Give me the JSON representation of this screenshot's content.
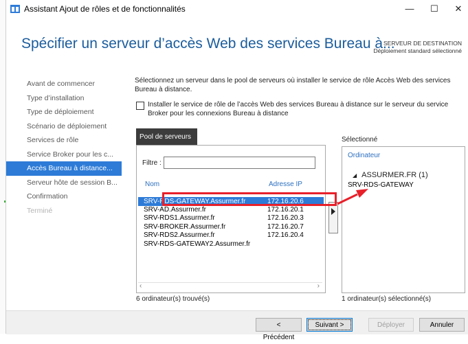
{
  "window": {
    "title": "Assistant Ajout de rôles et de fonctionnalités",
    "minimize": "—",
    "maximize": "☐",
    "close": "✕"
  },
  "header": {
    "heading": "Spécifier un serveur d’accès Web des services Bureau à...",
    "destination_label": "SERVEUR DE DESTINATION",
    "destination_value": "Déploiement standard sélectionné"
  },
  "nav": {
    "items": [
      {
        "label": "Avant de commencer",
        "state": "normal"
      },
      {
        "label": "Type d’installation",
        "state": "normal"
      },
      {
        "label": "Type de déploiement",
        "state": "normal"
      },
      {
        "label": "Scénario de déploiement",
        "state": "normal"
      },
      {
        "label": "Services de rôle",
        "state": "normal"
      },
      {
        "label": "Service Broker pour les c...",
        "state": "normal"
      },
      {
        "label": "Accès Bureau à distance...",
        "state": "active"
      },
      {
        "label": "Serveur hôte de session B...",
        "state": "normal"
      },
      {
        "label": "Confirmation",
        "state": "normal"
      },
      {
        "label": "Terminé",
        "state": "disabled"
      }
    ]
  },
  "content": {
    "description": "Sélectionnez un serveur dans le pool de serveurs où installer le service de rôle Accès Web des services Bureau à distance.",
    "checkbox_label": "Installer le service de rôle de l’accès Web des services Bureau à distance sur le serveur du service Broker pour les connexions Bureau à distance",
    "checkbox_checked": false
  },
  "pool": {
    "tab_label": "Pool de serveurs",
    "filter_label": "Filtre :",
    "filter_value": "",
    "col_name": "Nom",
    "col_ip": "Adresse IP",
    "rows": [
      {
        "name": "SRV-RDS-GATEWAY.Assurmer.fr",
        "ip": "172.16.20.6",
        "selected": true
      },
      {
        "name": "SRV-AD.Assurmer.fr",
        "ip": "172.16.20.1",
        "selected": false
      },
      {
        "name": "SRV-RDS1.Assurmer.fr",
        "ip": "172.16.20.3",
        "selected": false
      },
      {
        "name": "SRV-BROKER.Assurmer.fr",
        "ip": "172.16.20.7",
        "selected": false
      },
      {
        "name": "SRV-RDS2.Assurmer.fr",
        "ip": "172.16.20.4",
        "selected": false
      },
      {
        "name": "SRV-RDS-GATEWAY2.Assurmer.fr",
        "ip": "",
        "selected": false
      }
    ],
    "count_text": "6 ordinateur(s) trouvé(s)"
  },
  "selected": {
    "label": "Sélectionné",
    "col": "Ordinateur",
    "group": "ASSURMER.FR (1)",
    "server": "SRV-RDS-GATEWAY",
    "count_text": "1 ordinateur(s) sélectionné(s)"
  },
  "footer": {
    "prev": "< Précédent",
    "next": "Suivant >",
    "deploy": "Déployer",
    "cancel": "Annuler"
  },
  "colors": {
    "accent": "#2d7bd7",
    "heading": "#1a5c9c",
    "annotation": "#e8202a"
  }
}
